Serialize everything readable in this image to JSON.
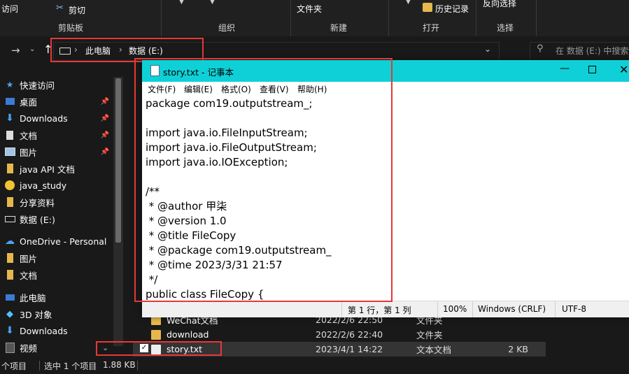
{
  "ribbon": {
    "access_label": "访问",
    "cut_label": "剪切",
    "clipboard_label": "剪贴板",
    "organize_label": "组织",
    "new_label": "新建",
    "open_label": "打开",
    "select_label": "选择",
    "folder_label": "文件夹",
    "history_label": "历史记录",
    "invert_label": "反向选择"
  },
  "address": {
    "crumbs": [
      "此电脑",
      "数据 (E:)"
    ],
    "search_placeholder": "在 数据 (E:) 中搜索"
  },
  "sidebar": {
    "items": [
      {
        "label": "快速访问",
        "icon": "star-icon",
        "pinned": false
      },
      {
        "label": "桌面",
        "icon": "desktop-icon",
        "pinned": true
      },
      {
        "label": "Downloads",
        "icon": "download-icon",
        "pinned": true
      },
      {
        "label": "文档",
        "icon": "document-icon",
        "pinned": true
      },
      {
        "label": "图片",
        "icon": "picture-icon",
        "pinned": true
      },
      {
        "label": "java API 文档",
        "icon": "folder-icon",
        "pinned": false
      },
      {
        "label": "java_study",
        "icon": "emoji-folder-icon",
        "pinned": false
      },
      {
        "label": "分享资料",
        "icon": "folder-icon",
        "pinned": false
      },
      {
        "label": "数据 (E:)",
        "icon": "drive-icon",
        "pinned": false
      },
      {
        "label": "OneDrive - Personal",
        "icon": "cloud-icon",
        "pinned": false
      },
      {
        "label": "图片",
        "icon": "folder-icon",
        "pinned": false
      },
      {
        "label": "文档",
        "icon": "folder-icon",
        "pinned": false
      },
      {
        "label": "此电脑",
        "icon": "computer-icon",
        "pinned": false
      },
      {
        "label": "3D 对象",
        "icon": "cube-icon",
        "pinned": false
      },
      {
        "label": "Downloads",
        "icon": "download-icon",
        "pinned": false
      },
      {
        "label": "视频",
        "icon": "video-icon",
        "pinned": false
      }
    ]
  },
  "files": [
    {
      "name": "WeChat文档",
      "date": "2022/2/6 22:50",
      "type": "文件夹",
      "size": ""
    },
    {
      "name": "download",
      "date": "2022/2/6 22:40",
      "type": "文件夹",
      "size": ""
    },
    {
      "name": "story.txt",
      "date": "2023/4/1 14:22",
      "type": "文本文档",
      "size": "2 KB"
    }
  ],
  "statusbar": {
    "count": "个项目",
    "selected": "选中 1 个项目",
    "size": "1.88 KB"
  },
  "notepad": {
    "title": "story.txt - 记事本",
    "menu": [
      "文件(F)",
      "编辑(E)",
      "格式(O)",
      "查看(V)",
      "帮助(H)"
    ],
    "content": "package com19.outputstream_;\n\nimport java.io.FileInputStream;\nimport java.io.FileOutputStream;\nimport java.io.IOException;\n\n/**\n * @author 甲柒\n * @version 1.0\n * @title FileCopy\n * @package com19.outputstream_\n * @time 2023/3/31 21:57\n */\npublic class FileCopy {",
    "status": {
      "position": "第 1 行，第 1 列",
      "zoom": "100%",
      "eol": "Windows (CRLF)",
      "encoding": "UTF-8"
    }
  },
  "colors": {
    "titlebar": "#0fd0d6",
    "highlight": "#e53935",
    "explorer_bg": "#191919"
  }
}
